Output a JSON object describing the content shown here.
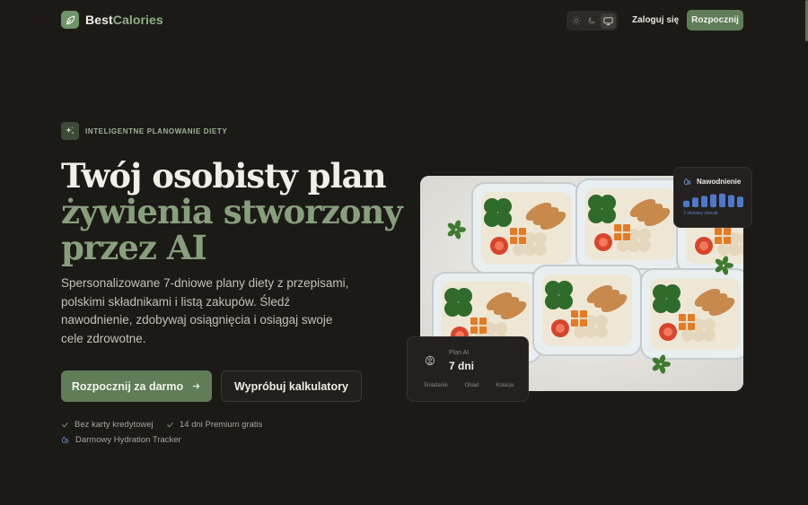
{
  "header": {
    "logo_primary": "Best",
    "logo_secondary": "Calories",
    "theme_modes": [
      "light",
      "dark",
      "system"
    ],
    "theme_selected": "system",
    "login_label": "Zaloguj się",
    "start_label": "Rozpocznij"
  },
  "hero": {
    "badge": "INTELIGENTNE PLANOWANIE DIETY",
    "headline_line1": "Twój osobisty plan",
    "headline_line2": "żywienia stworzony",
    "headline_line3": "przez AI",
    "description": "Spersonalizowane 7-dniowe plany diety z przepisami, polskimi składnikami i listą zakupów. Śledź nawodnienie, zdobywaj osiągnięcia i osiągaj swoje cele zdrowotne.",
    "cta_primary": "Rozpocznij za darmo",
    "cta_secondary": "Wypróbuj kalkulatory",
    "perks": [
      "Bez karty kredytowej",
      "14 dni Premium gratis",
      "Darmowy Hydration Tracker"
    ]
  },
  "hydration_card": {
    "title": "Nawodnienie",
    "streak": "7-dniowy streak",
    "bar_levels": [
      0.4,
      0.6,
      0.7,
      0.8,
      0.85,
      0.75,
      0.65
    ]
  },
  "plan_card": {
    "subtitle": "Plan AI",
    "main": "7 dni",
    "meals": [
      "Śniadanie",
      "Obiad",
      "Kolacja"
    ]
  },
  "colors": {
    "background": "#1c1a17",
    "accent": "#5f7d57",
    "accent_text": "#879f7d",
    "hydration_blue": "#4f78c8"
  }
}
